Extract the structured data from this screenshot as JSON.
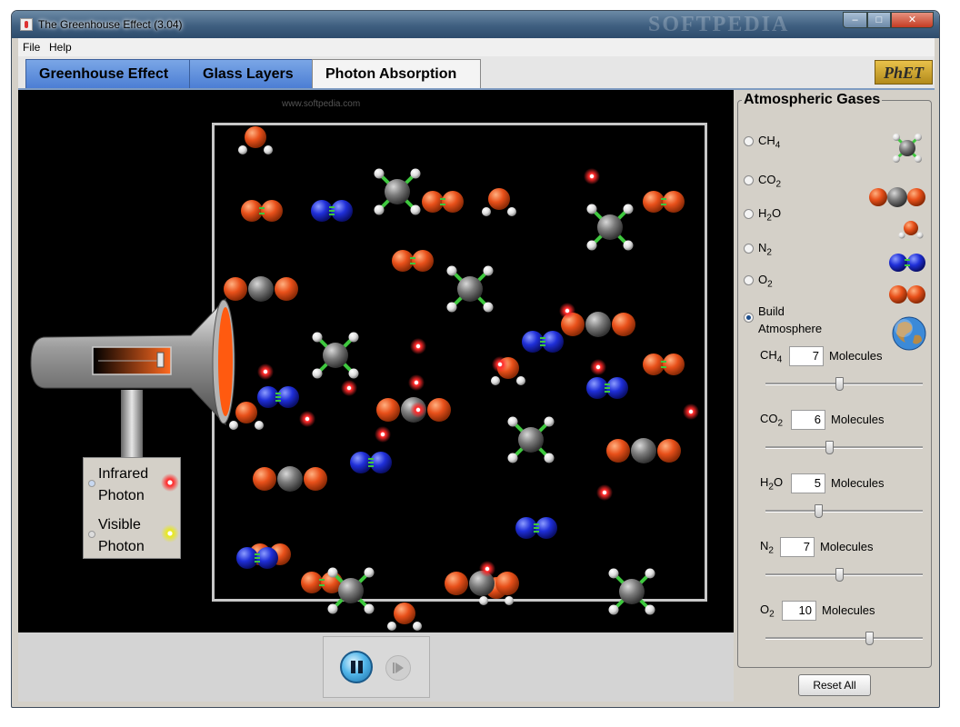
{
  "window": {
    "title": "The Greenhouse Effect (3.04)",
    "watermark": "SOFTPEDIA",
    "minimize": "–",
    "maximize": "□",
    "close": "✕"
  },
  "menu": [
    {
      "label": "File"
    },
    {
      "label": "Help"
    }
  ],
  "tabs": [
    {
      "label": "Greenhouse Effect",
      "active": false
    },
    {
      "label": "Glass Layers",
      "active": false
    },
    {
      "label": "Photon Absorption",
      "active": true
    }
  ],
  "logo": "PhET",
  "watermark_url": "www.softpedia.com",
  "photon_selector": {
    "options": [
      {
        "line1": "Infrared",
        "line2": "Photon",
        "selected": true
      },
      {
        "line1": "Visible",
        "line2": "Photon",
        "selected": false
      }
    ]
  },
  "panel": {
    "title": "Atmospheric Gases",
    "gases": [
      {
        "base": "CH",
        "sub": "4",
        "icon": "ch4-molecule-icon",
        "selected": false
      },
      {
        "base": "CO",
        "sub": "2",
        "icon": "co2-molecule-icon",
        "selected": false
      },
      {
        "base": "H",
        "sub": "2",
        "tail": "O",
        "icon": "h2o-molecule-icon",
        "selected": false
      },
      {
        "base": "N",
        "sub": "2",
        "icon": "n2-molecule-icon",
        "selected": false
      },
      {
        "base": "O",
        "sub": "2",
        "icon": "o2-molecule-icon",
        "selected": false
      }
    ],
    "build": {
      "line1": "Build",
      "line2": "Atmosphere",
      "selected": true,
      "icon": "earth-icon"
    },
    "unit": "Molecules",
    "counts": [
      {
        "base": "CH",
        "sub": "4",
        "tail": "",
        "value": "7",
        "slider_fraction": 0.47
      },
      {
        "base": "CO",
        "sub": "2",
        "tail": "",
        "value": "6",
        "slider_fraction": 0.4
      },
      {
        "base": "H",
        "sub": "2",
        "tail": "O",
        "value": "5",
        "slider_fraction": 0.33
      },
      {
        "base": "N",
        "sub": "2",
        "tail": "",
        "value": "7",
        "slider_fraction": 0.47
      },
      {
        "base": "O",
        "sub": "2",
        "tail": "",
        "value": "10",
        "slider_fraction": 0.67
      }
    ]
  },
  "reset_label": "Reset All",
  "colors": {
    "oxygen": "#e8501a",
    "carbon": "#7a7a7a",
    "nitrogen": "#1f2fd8",
    "hydrogen": "#e8e8e8",
    "bond_green": "#3ec83e",
    "photon_red": "#ff2a2a"
  }
}
